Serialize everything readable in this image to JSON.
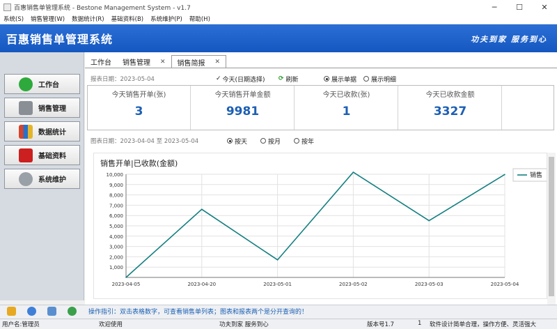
{
  "window": {
    "title": "百惠销售单管理系统 - Bestone Management System - v1.7",
    "controls": [
      "─",
      "☐",
      "✕"
    ]
  },
  "menu": [
    "系统(S)",
    "销售管理(W)",
    "数据统计(R)",
    "基础资料(B)",
    "系统维护(P)",
    "帮助(H)"
  ],
  "banner": {
    "app_title": "百惠销售单管理系统",
    "slogan": "功夫到家  服务到心"
  },
  "sidebar": {
    "items": [
      {
        "label": "工作台",
        "icon": "checkmark-icon",
        "color": "#2eaa3c"
      },
      {
        "label": "销售管理",
        "icon": "printer-icon",
        "color": "#8a8f96"
      },
      {
        "label": "数据统计",
        "icon": "books-icon",
        "color": "#d6452b"
      },
      {
        "label": "基础资料",
        "icon": "red-book-icon",
        "color": "#cc1f1f"
      },
      {
        "label": "系统维护",
        "icon": "gear-icon",
        "color": "#9aa0a8"
      }
    ]
  },
  "tabs": [
    {
      "label": "工作台",
      "closable": false
    },
    {
      "label": "销售管理",
      "closable": true
    },
    {
      "label": "销售简报",
      "closable": true,
      "active": true
    }
  ],
  "report": {
    "date_label": "报表日期：2023-05-04",
    "today_option": "今天(日期选择)",
    "refresh": "刷新",
    "view_summary": "展示单据",
    "view_detail": "展示明细"
  },
  "stats": [
    {
      "label": "今天销售开单(张)",
      "value": "3"
    },
    {
      "label": "今天销售开单金额",
      "value": "9981"
    },
    {
      "label": "今天已收款(张)",
      "value": "1"
    },
    {
      "label": "今天已收款金额",
      "value": "3327"
    }
  ],
  "chart_range": {
    "label": "图表日期：2023-04-04 至 2023-05-04",
    "by_day": "按天",
    "by_month": "按月",
    "by_year": "按年"
  },
  "chart_data": {
    "type": "line",
    "title": "销售开单|已收款(金额)",
    "x": [
      "2023-04-05",
      "2023-04-20",
      "2023-05-01",
      "2023-05-02",
      "2023-05-03",
      "2023-05-04"
    ],
    "series": [
      {
        "name": "销售",
        "values": [
          0,
          6600,
          1700,
          10200,
          5500,
          9981
        ],
        "color": "#137f80"
      }
    ],
    "ylim": [
      0,
      10000
    ],
    "yticks": [
      "1,000",
      "2,000",
      "3,000",
      "4,000",
      "5,000",
      "6,000",
      "7,000",
      "8,000",
      "9,000",
      "10,000"
    ],
    "grid": true,
    "legend": "right"
  },
  "tip": "操作指引：双击表格数字，可查看销售单列表；图表和报表两个是分开查询的！",
  "status": {
    "user": "用户名:管理员",
    "welcome": "欢迎使用",
    "motto": "功夫到家 服务到心",
    "version": "版本号1.7",
    "count": "1",
    "message": "软件设计简单合理，操作方便、灵活强大"
  }
}
